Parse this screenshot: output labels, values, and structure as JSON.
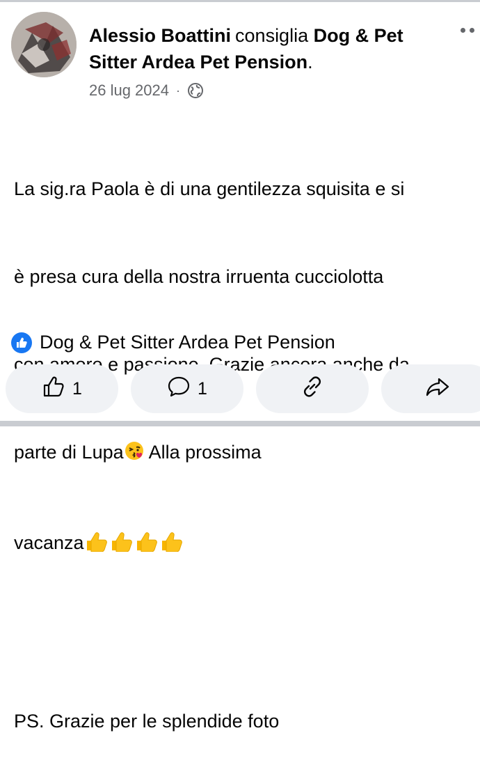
{
  "post": {
    "author": "Alessio Boattini",
    "verb": "consiglia",
    "page": "Dog & Pet Sitter Ardea Pet Pension",
    "end_punct": ".",
    "date": "26 lug 2024",
    "separator": "·",
    "privacy_icon": "globe-icon",
    "text_line1": "La sig.ra Paola è di una gentilezza squisita e si",
    "text_line2": "è presa cura della nostra irruenta cucciolotta",
    "text_line3": "con amore e passione. Grazie ancora anche da",
    "text_line4a": "parte di Lupa",
    "text_line4b": " Alla prossima",
    "text_line5": "vacanza",
    "text_ps": "PS. Grazie per le splendide foto",
    "emoji_kiss": "face-blowing-kiss-icon",
    "emoji_thumbs": "thumbs-up-icon"
  },
  "recommendation": {
    "icon": "like-badge-icon",
    "label": "Dog & Pet Sitter Ardea Pet Pension"
  },
  "actions": {
    "like_count": "1",
    "comment_count": "1",
    "like_icon": "thumbs-up-outline-icon",
    "comment_icon": "comment-bubble-icon",
    "link_icon": "link-icon",
    "share_icon": "share-arrow-icon"
  },
  "colors": {
    "accent": "#1877f2",
    "secondary_text": "#65676b",
    "pill_bg": "#f0f2f5"
  }
}
